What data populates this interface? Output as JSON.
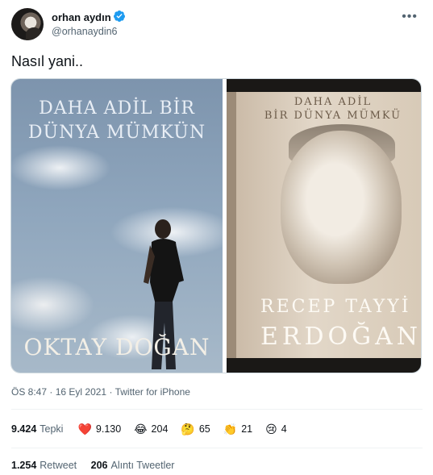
{
  "author": {
    "display_name": "orhan aydın",
    "handle": "@orhanaydin6",
    "verified": true,
    "more_icon": "more-dots-icon"
  },
  "tweet": {
    "text": "Nasıl yani.."
  },
  "media": {
    "left_image": {
      "line1": "DAHA ADİL BİR",
      "line2": "DÜNYA MÜMKÜN",
      "author": "OKTAY DOĞAN"
    },
    "right_image": {
      "line1": "DAHA ADİL",
      "line2": "BİR DÜNYA MÜMKÜ",
      "author_first": "RECEP TAYYİ",
      "author_last": "ERDOĞAN"
    }
  },
  "meta": {
    "time": "ÖS 8:47",
    "date": "16 Eyl 2021",
    "source": "Twitter for iPhone",
    "separator": "·"
  },
  "reactions": {
    "total": "9.424",
    "total_label": "Tepki",
    "items": [
      {
        "emoji": "❤️",
        "icon": "heart-icon",
        "count": "9.130"
      },
      {
        "emoji": "😂",
        "icon": "laughing-icon",
        "count": "204"
      },
      {
        "emoji": "🤔",
        "icon": "thinking-icon",
        "count": "65"
      },
      {
        "emoji": "👏",
        "icon": "clapping-icon",
        "count": "21"
      },
      {
        "emoji": "😢",
        "icon": "crying-icon",
        "count": "4"
      }
    ]
  },
  "stats": {
    "retweets": "1.254",
    "retweets_label": "Retweet",
    "quotes": "206",
    "quotes_label": "Alıntı Tweetler"
  },
  "colors": {
    "text": "#0f1419",
    "secondary": "#536471",
    "verified": "#1d9bf0",
    "border": "#eff3f4"
  }
}
